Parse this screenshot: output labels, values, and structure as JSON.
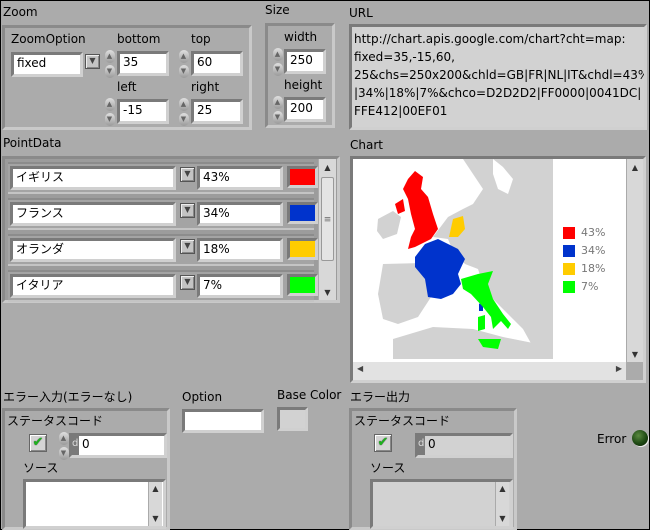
{
  "zoom": {
    "label": "Zoom",
    "zoom_option_label": "ZoomOption",
    "zoom_option_value": "fixed",
    "bottom_label": "bottom",
    "bottom_value": "35",
    "top_label": "top",
    "top_value": "60",
    "left_label": "left",
    "left_value": "-15",
    "right_label": "right",
    "right_value": "25"
  },
  "size": {
    "label": "Size",
    "width_label": "width",
    "width_value": "250",
    "height_label": "height",
    "height_value": "200"
  },
  "url": {
    "label": "URL",
    "lines": [
      "http://chart.apis.google.com/chart?cht=map:",
      "fixed=35,-15,60,",
      "25&chs=250x200&chld=GB|FR|NL|IT&chdl=43%",
      "|34%|18%|7%&chco=D2D2D2|FF0000|0041DC|",
      "FFE412|00EF01"
    ]
  },
  "point_data": {
    "label": "PointData",
    "rows": [
      {
        "country": "イギリス",
        "value": "43%",
        "color": "#FF0000"
      },
      {
        "country": "フランス",
        "value": "34%",
        "color": "#0033CC"
      },
      {
        "country": "オランダ",
        "value": "18%",
        "color": "#FFCC00"
      },
      {
        "country": "イタリア",
        "value": "7%",
        "color": "#00FF00"
      }
    ]
  },
  "chart": {
    "label": "Chart",
    "base_color": "#D2D2D2",
    "legend": [
      {
        "text": "43%",
        "color": "#FF0000"
      },
      {
        "text": "34%",
        "color": "#0033CC"
      },
      {
        "text": "18%",
        "color": "#FFCC00"
      },
      {
        "text": "7%",
        "color": "#00FF00"
      }
    ],
    "regions": [
      {
        "code": "GB",
        "color": "#FF0000"
      },
      {
        "code": "FR",
        "color": "#0033CC"
      },
      {
        "code": "NL",
        "color": "#FFCC00"
      },
      {
        "code": "IT",
        "color": "#00FF00"
      }
    ]
  },
  "error_in": {
    "label": "エラー入力(エラーなし)",
    "status_label": "ステータスコード",
    "status_ok": "✔",
    "code_prefix": "d",
    "code_value": "0",
    "source_label": "ソース",
    "source_value": ""
  },
  "option": {
    "label": "Option",
    "value": ""
  },
  "base_color": {
    "label": "Base Color",
    "color": "#D2D2D2"
  },
  "error_out": {
    "label": "エラー出力",
    "status_label": "ステータスコード",
    "status_ok": "✔",
    "code_prefix": "d",
    "code_value": "0",
    "source_label": "ソース",
    "source_value": ""
  },
  "error_indicator": {
    "label": "Error",
    "state": "off"
  }
}
